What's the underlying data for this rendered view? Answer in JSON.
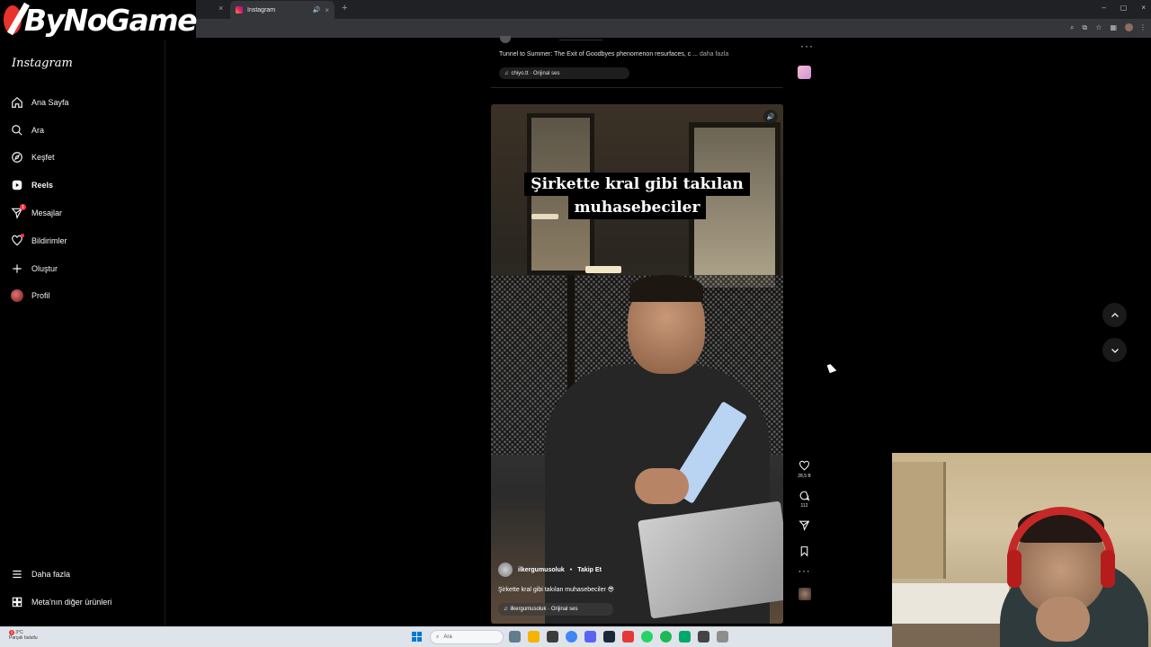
{
  "browser": {
    "active_tab_title": "Instagram",
    "tab_close_glyph": "×",
    "new_tab_glyph": "+",
    "window_controls": [
      "–",
      "▢",
      "×"
    ]
  },
  "overlay_logo": {
    "text": "ByNoGame"
  },
  "sidebar": {
    "logo": "Instagram",
    "items": [
      {
        "label": "Ana Sayfa",
        "icon": "home-icon"
      },
      {
        "label": "Ara",
        "icon": "search-icon"
      },
      {
        "label": "Keşfet",
        "icon": "compass-icon"
      },
      {
        "label": "Reels",
        "icon": "reels-icon",
        "active": true
      },
      {
        "label": "Mesajlar",
        "icon": "messages-icon",
        "badge": "1"
      },
      {
        "label": "Bildirimler",
        "icon": "heart-icon",
        "dot": true
      },
      {
        "label": "Oluştur",
        "icon": "plus-icon"
      },
      {
        "label": "Profil",
        "icon": "profile-avatar"
      }
    ],
    "bottom_items": [
      {
        "label": "Daha fazla",
        "icon": "menu-icon"
      },
      {
        "label": "Meta'nın diğer ürünleri",
        "icon": "meta-apps-icon"
      }
    ]
  },
  "previous_post": {
    "caption": "Tunnel to Summer: The Exit of Goodbyes phenomenon resurfaces, c ...",
    "more_label": "daha fazla",
    "audio": "chiyo.tt · Orijinal ses"
  },
  "reel": {
    "overlay_caption_line1": "Şirkette kral gibi takılan",
    "overlay_caption_line2": "muhasebeciler",
    "username": "ilkergumusoluk",
    "separator": "•",
    "follow_label": "Takip Et",
    "caption": "Şirkette kral gibi takılan muhasebeciler 😎",
    "audio": "ilkergumusoluk · Orijinal ses",
    "likes": "28,5 B",
    "comments": "112"
  },
  "taskbar": {
    "weather_temp": "3°C",
    "weather_desc": "Parçalı bulutlu",
    "weather_badge": "3",
    "search_placeholder": "Ara"
  },
  "colors": {
    "background": "#000000",
    "notification_red": "#ff3040",
    "headset_red": "#c62828",
    "windows_blue": "#0078d4"
  }
}
